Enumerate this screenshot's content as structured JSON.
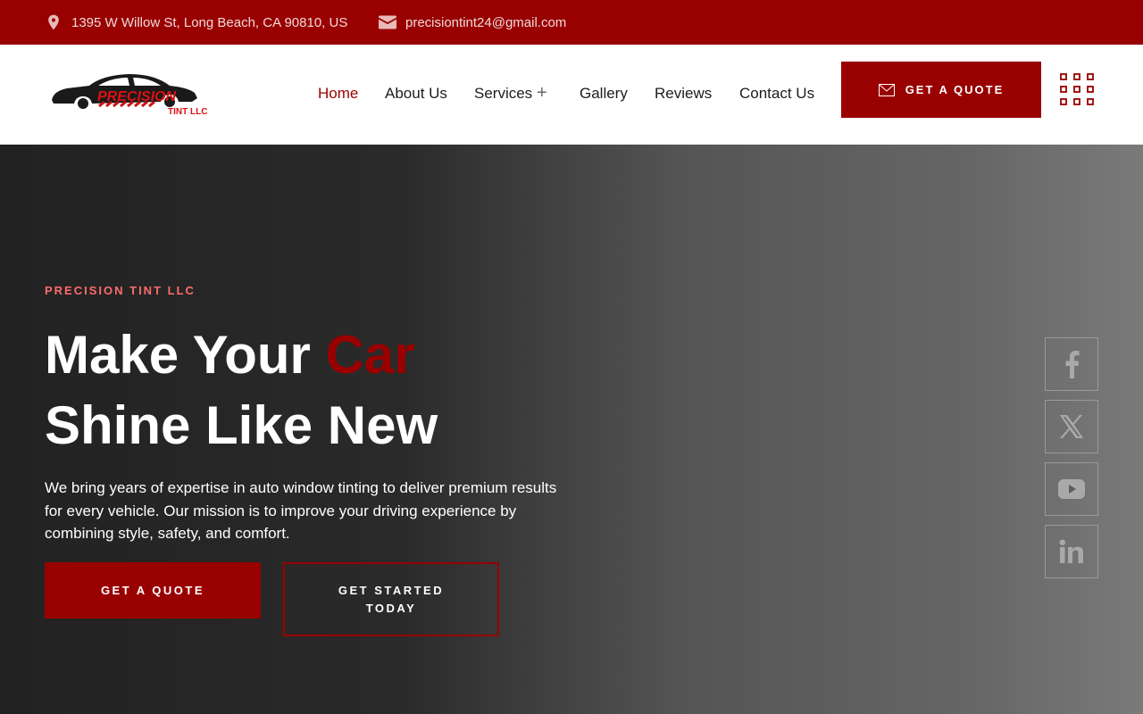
{
  "topbar": {
    "address": "1395 W Willow St, Long Beach, CA 90810, US",
    "email": "precisiontint24@gmail.com",
    "address_icon": "map-pin-icon",
    "email_icon": "envelope-icon"
  },
  "logo": {
    "line1": "PRECISION",
    "line2": "TINT LLC"
  },
  "nav": {
    "home": "Home",
    "about": "About Us",
    "services": "Services",
    "gallery": "Gallery",
    "reviews": "Reviews",
    "contact": "Contact Us",
    "active": "Home"
  },
  "header": {
    "quote_label": "GET A QUOTE"
  },
  "hero": {
    "eyebrow": "PRECISION TINT LLC",
    "title_part1": "Make Your ",
    "title_accent": "Car",
    "title_line2": "Shine Like New",
    "description": "We bring years of expertise in auto window tinting to deliver premium results for every vehicle. Our mission is to improve your driving experience by combining style, safety, and comfort.",
    "primary_button": "GET A QUOTE",
    "secondary_button": "GET STARTED TODAY"
  },
  "social": [
    "facebook-icon",
    "x-twitter-icon",
    "youtube-icon",
    "linkedin-icon"
  ],
  "colors": {
    "brand": "#990000",
    "eyebrow": "#ff6b6b"
  }
}
